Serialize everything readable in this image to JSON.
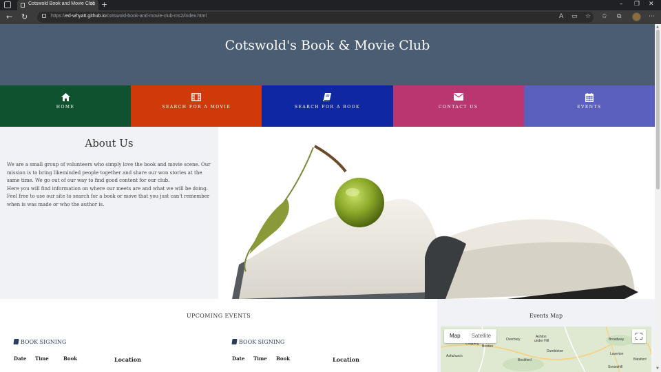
{
  "browser": {
    "tab_title": "Cotswold Book and Movie Club",
    "url_host": "ed-whyatt.github.io",
    "url_prefix": "https://",
    "url_path": "/cotswold-book-and-movie-club-ms2/index.html"
  },
  "site": {
    "title": "Cotswold's Book & Movie Club"
  },
  "nav": {
    "items": [
      {
        "label": "HOME",
        "icon": "home-icon",
        "color": "#0f5230"
      },
      {
        "label": "SEARCH FOR A MOVIE",
        "icon": "film-icon",
        "color": "#d03a0b"
      },
      {
        "label": "SEARCH FOR A BOOK",
        "icon": "book-icon",
        "color": "#0f27a3"
      },
      {
        "label": "CONTACT US",
        "icon": "envelope-icon",
        "color": "#b93671"
      },
      {
        "label": "EVENTS",
        "icon": "calendar-icon",
        "color": "#5b5fbe"
      }
    ]
  },
  "about": {
    "title": "About Us",
    "paragraph1": "We are a small group of volunteers who simply love the book and movie scene. Our mission is to bring likeminded people together and share our won stories at the same time. We go out of our way to find good content for our club.",
    "paragraph2": "Here you will find information on where our meets are and what we will be doing. Feel free to use our site to search for a book or move that you just can't remember when is was made or who the author is."
  },
  "events": {
    "title": "UPCOMING EVENTS",
    "cards": [
      {
        "heading": "BOOK SIGNING",
        "columns": {
          "date": "Date",
          "time": "Time",
          "book": "Book",
          "location": "Location"
        }
      },
      {
        "heading": "BOOK SIGNING",
        "columns": {
          "date": "Date",
          "time": "Time",
          "book": "Book",
          "location": "Location"
        }
      }
    ]
  },
  "map": {
    "title": "Events Map",
    "type_map": "Map",
    "type_satellite": "Satellite",
    "places": [
      "Chipping",
      "Ashton",
      "under Hill",
      "Broadway",
      "Dumbleton",
      "Laverton",
      "Beckford",
      "Snowshill",
      "Batsford",
      "Bredon",
      "Overbury",
      "Ashchurch"
    ]
  }
}
